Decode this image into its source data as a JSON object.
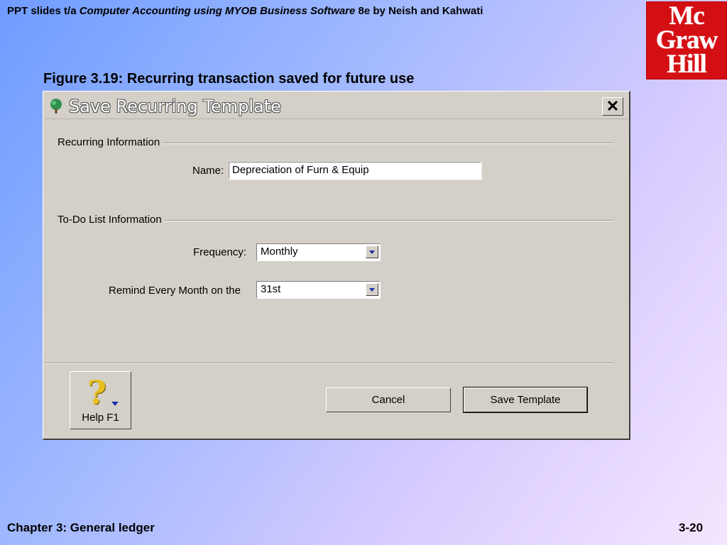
{
  "header": {
    "prefix": "PPT slides t/a",
    "book_title": "Computer Accounting using MYOB Business Software",
    "suffix": "8e by Neish and Kahwati"
  },
  "logo": {
    "line1": "Mc",
    "line2": "Graw",
    "line3": "Hill"
  },
  "figure_title": "Figure 3.19: Recurring transaction saved for future use",
  "dialog": {
    "title": "Save Recurring Template",
    "close_label": "✕",
    "recurring_section": "Recurring Information",
    "name_label": "Name:",
    "name_value": "Depreciation of Furn & Equip",
    "todo_section": "To-Do List Information",
    "frequency_label": "Frequency:",
    "frequency_value": "Monthly",
    "remind_label": "Remind Every Month on the",
    "remind_value": "31st",
    "help_label": "Help F1",
    "cancel_label": "Cancel",
    "save_label": "Save Template"
  },
  "footer": {
    "chapter": "Chapter 3: General ledger",
    "page": "3-20"
  },
  "colors": {
    "accent_logo": "#d40f14",
    "dialog_bg": "#d4d0c8",
    "dropdown_arrow": "#1a2fa0"
  }
}
